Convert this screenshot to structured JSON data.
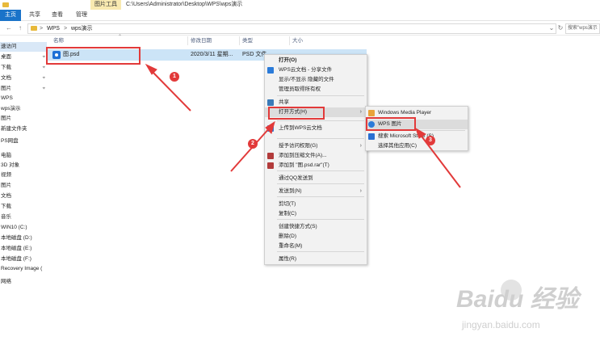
{
  "window": {
    "picture_tools_tab": "图片工具",
    "path_title": "C:\\Users\\Administrator\\Desktop\\WPS\\wps演示"
  },
  "ribbon": {
    "tabs": [
      {
        "label": "主页",
        "active": true
      },
      {
        "label": "共享",
        "active": false
      },
      {
        "label": "查看",
        "active": false
      },
      {
        "label": "管理",
        "active": false
      }
    ]
  },
  "address": {
    "crumbs": [
      "WPS",
      "wps演示"
    ],
    "separator": ">",
    "search_placeholder": "搜索\"wps演示"
  },
  "sidebar": {
    "items": [
      {
        "label": "速访问",
        "pinned": false,
        "selected": true
      },
      {
        "label": "桌面",
        "pinned": true,
        "selected": false
      },
      {
        "label": "下载",
        "pinned": true,
        "selected": false
      },
      {
        "label": "文档",
        "pinned": true,
        "selected": false
      },
      {
        "label": "图片",
        "pinned": true,
        "selected": false
      },
      {
        "label": "WPS",
        "pinned": false,
        "selected": false
      },
      {
        "label": "wps演示",
        "pinned": false,
        "selected": false
      },
      {
        "label": "图片",
        "pinned": false,
        "selected": false
      },
      {
        "label": "新建文件夹",
        "pinned": false,
        "selected": false
      },
      {
        "label": "PS网盘",
        "pinned": false,
        "selected": false
      },
      {
        "label": "电脑",
        "pinned": false,
        "selected": false
      },
      {
        "label": "3D 对象",
        "pinned": false,
        "selected": false
      },
      {
        "label": "视频",
        "pinned": false,
        "selected": false
      },
      {
        "label": "图片",
        "pinned": false,
        "selected": false
      },
      {
        "label": "文档",
        "pinned": false,
        "selected": false
      },
      {
        "label": "下载",
        "pinned": false,
        "selected": false
      },
      {
        "label": "音乐",
        "pinned": false,
        "selected": false
      },
      {
        "label": "WIN10 (C:)",
        "pinned": false,
        "selected": false
      },
      {
        "label": "本地磁盘 (D:)",
        "pinned": false,
        "selected": false
      },
      {
        "label": "本地磁盘 (E:)",
        "pinned": false,
        "selected": false
      },
      {
        "label": "本地磁盘 (F:)",
        "pinned": false,
        "selected": false
      },
      {
        "label": "Recovery Image (",
        "pinned": false,
        "selected": false
      },
      {
        "label": "网络",
        "pinned": false,
        "selected": false
      }
    ]
  },
  "columns": {
    "name": "名称",
    "date": "修改日期",
    "type": "类型",
    "size": "大小"
  },
  "file": {
    "name": "图.psd",
    "date": "2020/3/11 星期...",
    "type": "PSD 文件",
    "size": "  "
  },
  "context_menu": {
    "items": [
      {
        "label": "打开(O)",
        "bold": true,
        "arrow": false
      },
      {
        "label": "WPS云文档 - 分享文件",
        "bold": false,
        "arrow": false,
        "icon": "wps-cloud-icon"
      },
      {
        "label": "显示/不显示 隐藏的文件",
        "bold": false,
        "arrow": false
      },
      {
        "label": "管理员取得所有权",
        "bold": false,
        "arrow": false
      },
      {
        "label": "共享",
        "bold": false,
        "arrow": false,
        "icon": "share-icon"
      },
      {
        "label": "打开方式(H)",
        "bold": false,
        "arrow": true,
        "hover": true
      },
      {
        "label": "上传到WPS云文档",
        "bold": false,
        "arrow": false,
        "icon": "wps-cloud-icon"
      },
      {
        "label": "授予访问权限(G)",
        "bold": false,
        "arrow": true
      },
      {
        "label": "添加到压缩文件(A)...",
        "bold": false,
        "arrow": false,
        "icon": "archive-icon"
      },
      {
        "label": "添加到 \"图.psd.rar\"(T)",
        "bold": false,
        "arrow": false,
        "icon": "archive-icon"
      },
      {
        "label": "通过QQ发送到",
        "bold": false,
        "arrow": false
      },
      {
        "label": "发送到(N)",
        "bold": false,
        "arrow": true
      },
      {
        "label": "剪切(T)",
        "bold": false,
        "arrow": false
      },
      {
        "label": "复制(C)",
        "bold": false,
        "arrow": false
      },
      {
        "label": "创建快捷方式(S)",
        "bold": false,
        "arrow": false
      },
      {
        "label": "删除(D)",
        "bold": false,
        "arrow": false
      },
      {
        "label": "重命名(M)",
        "bold": false,
        "arrow": false
      },
      {
        "label": "属性(R)",
        "bold": false,
        "arrow": false
      }
    ]
  },
  "open_with_menu": {
    "items": [
      {
        "label": "Windows Media Player",
        "icon": "media-player-icon",
        "hover": false
      },
      {
        "label": "WPS 图片",
        "icon": "wps-picture-icon",
        "hover": true
      },
      {
        "label": "搜索 Microsoft Store (S)",
        "icon": "store-icon",
        "hover": false
      },
      {
        "label": "选择其他应用(C)",
        "icon": "",
        "hover": false
      }
    ]
  },
  "annotations": {
    "badges": [
      "1",
      "2",
      "3"
    ],
    "highlight_color": "#e23a3a"
  },
  "watermark": {
    "brand": "Baidu 经验",
    "url": "jingyan.baidu.com"
  },
  "colors": {
    "accent": "#1a73c9",
    "selection": "#cce4f7",
    "menu_bg": "#f2f2f2"
  }
}
